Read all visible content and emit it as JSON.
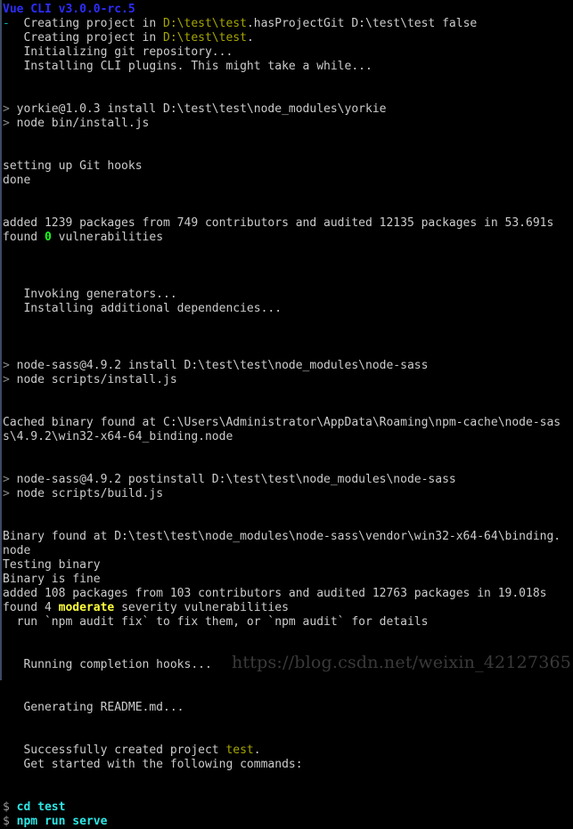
{
  "terminal": {
    "title": "Vue CLI v3.0.0-rc.5",
    "background_color": "#000000",
    "foreground_color": "#cccccc",
    "border_color": "#3c4a63",
    "colors": {
      "blue": "#2d2dff",
      "cyan": "#2ee6e6",
      "dark_yellow": "#a6a600",
      "bright_yellow": "#ffff3b",
      "green": "#1aff1a",
      "gray": "#8a8a8a",
      "white": "#cccccc"
    },
    "watermark": "https://blog.csdn.net/weixin_42127365",
    "spinner_glyph": "-",
    "prompt_glyph": "$",
    "npm_script_glyph": ">"
  },
  "lines": {
    "l01_title": "Vue CLI v3.0.0-rc.5",
    "l02_spinner": "-",
    "l02_a": "  Creating project in ",
    "l02_path": "D:\\test\\test",
    "l02_b": ".hasProjectGit D:\\test\\test false",
    "l03_a": "   Creating project in ",
    "l03_path": "D:\\test\\test",
    "l03_b": ".",
    "l04": "   Initializing git repository...",
    "l05": "   Installing CLI plugins. This might take a while...",
    "l06_gt": ">",
    "l06_text": " yorkie@1.0.3 install D:\\test\\test\\node_modules\\yorkie",
    "l07_gt": ">",
    "l07_text": " node bin/install.js",
    "l08": "setting up Git hooks",
    "l09": "done",
    "l10": "added 1239 packages from 749 contributors and audited 12135 packages in 53.691s",
    "l11_a": "found ",
    "l11_count": "0",
    "l11_b": " vulnerabilities",
    "l12": "   Invoking generators...",
    "l13": "   Installing additional dependencies...",
    "l14_gt": ">",
    "l14_text": " node-sass@4.9.2 install D:\\test\\test\\node_modules\\node-sass",
    "l15_gt": ">",
    "l15_text": " node scripts/install.js",
    "l16": "Cached binary found at C:\\Users\\Administrator\\AppData\\Roaming\\npm-cache\\node-sas",
    "l17": "s\\4.9.2\\win32-x64-64_binding.node",
    "l18_gt": ">",
    "l18_text": " node-sass@4.9.2 postinstall D:\\test\\test\\node_modules\\node-sass",
    "l19_gt": ">",
    "l19_text": " node scripts/build.js",
    "l20": "Binary found at D:\\test\\test\\node_modules\\node-sass\\vendor\\win32-x64-64\\binding.",
    "l21": "node",
    "l22": "Testing binary",
    "l23": "Binary is fine",
    "l24": "added 108 packages from 103 contributors and audited 12763 packages in 19.018s",
    "l25_a": "found 4 ",
    "l25_sev": "moderate",
    "l25_b": " severity vulnerabilities",
    "l26": "  run `npm audit fix` to fix them, or `npm audit` for details",
    "l27": "   Running completion hooks...",
    "l28": "   Generating README.md...",
    "l29_a": "   Successfully created project ",
    "l29_project": "test",
    "l29_b": ".",
    "l30": "   Get started with the following commands:",
    "l31_prompt": "$",
    "l31_cmd": "cd test",
    "l32_prompt": "$",
    "l32_cmd": "npm run serve"
  }
}
